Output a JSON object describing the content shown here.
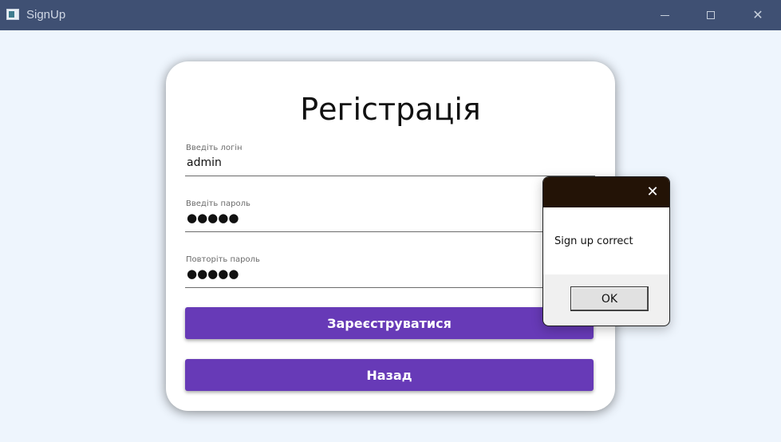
{
  "window": {
    "title": "SignUp",
    "minimize_glyph": "",
    "close_glyph": "✕"
  },
  "form": {
    "title": "Регістрація",
    "login": {
      "label": "Введіть логін",
      "value": "admin"
    },
    "password": {
      "label": "Введіть пароль",
      "value": "●●●●●"
    },
    "repeat": {
      "label": "Повторіть пароль",
      "value": "●●●●●"
    },
    "register_label": "Зареєструватися",
    "back_label": "Назад"
  },
  "dialog": {
    "message": "Sign up correct",
    "ok_label": "OK",
    "close_glyph": "✕"
  },
  "colors": {
    "titlebar": "#3f5073",
    "accent": "#673ab7",
    "dialog_header": "#231306",
    "background": "#eef5fd"
  }
}
